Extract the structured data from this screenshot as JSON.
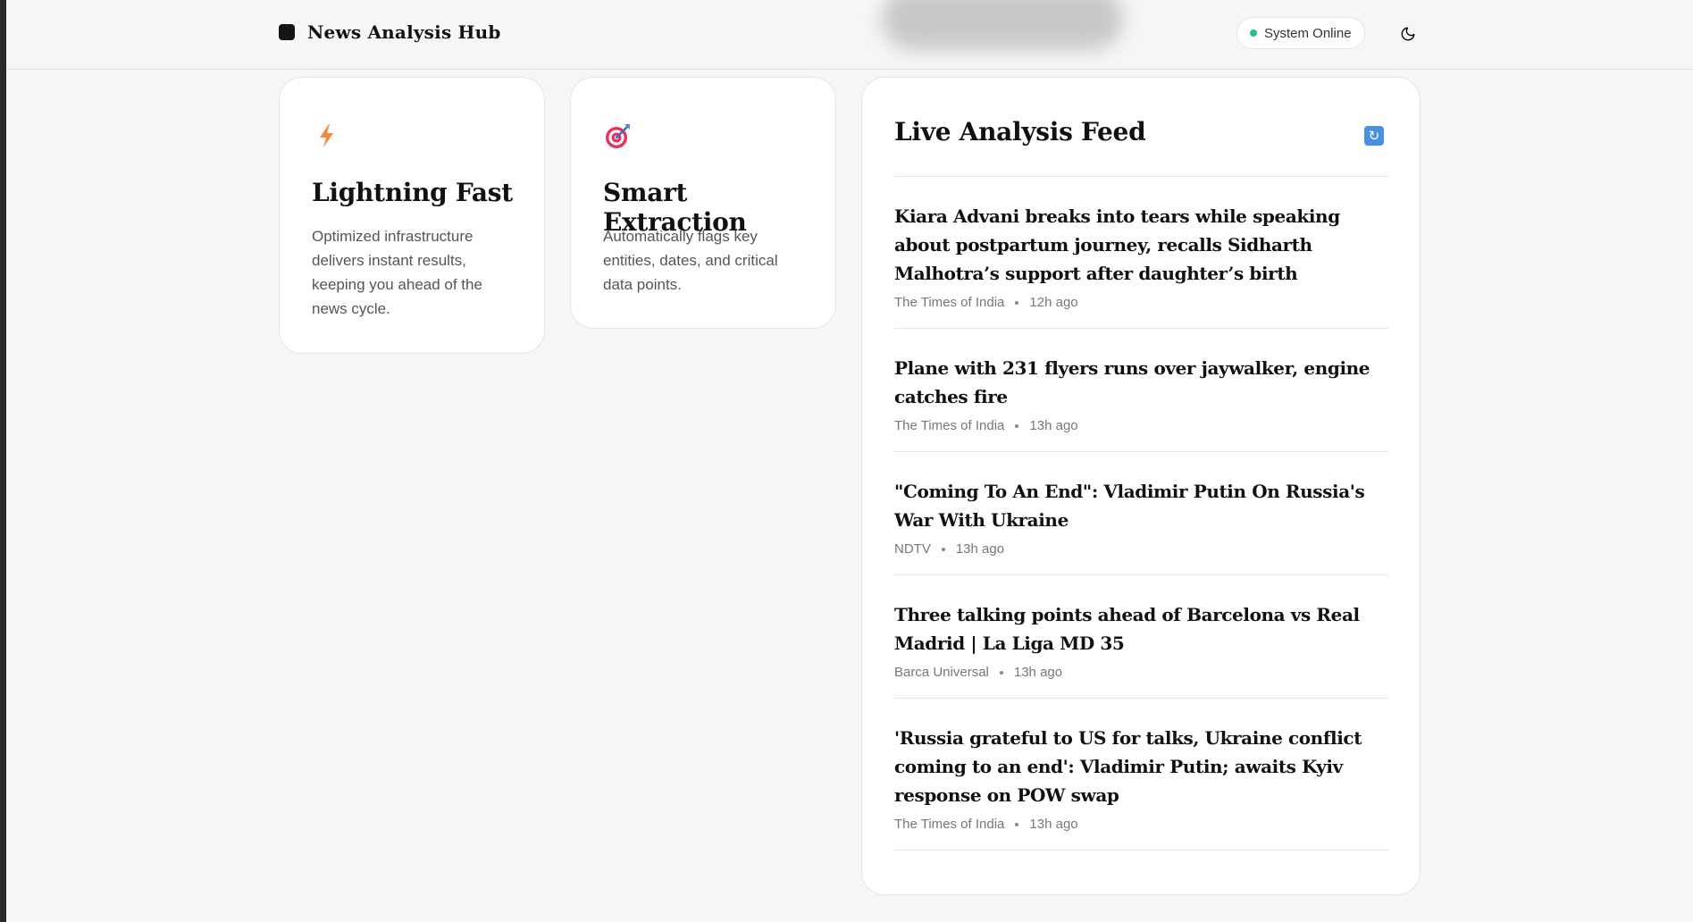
{
  "header": {
    "brand": "News Analysis Hub",
    "status": "System Online",
    "status_color": "#22c08b"
  },
  "features": [
    {
      "icon": "lightning-icon",
      "title": "Lightning Fast",
      "description": "Optimized infrastructure delivers instant results, keeping you ahead of the news cycle."
    },
    {
      "icon": "target-icon",
      "title": "Smart Extraction",
      "description": "Automatically flags key entities, dates, and critical data points."
    }
  ],
  "feed": {
    "title": "Live Analysis Feed",
    "refresh_icon": "refresh-icon",
    "items": [
      {
        "headline": "Kiara Advani breaks into tears while speaking about postpartum journey, recalls Sidharth Malhotra’s support after daughter’s birth",
        "source": "The Times of India",
        "time": "12h ago"
      },
      {
        "headline": "Plane with 231 flyers runs over jaywalker, engine catches fire",
        "source": "The Times of India",
        "time": "13h ago"
      },
      {
        "headline": "\"Coming To An End\": Vladimir Putin On Russia's War With Ukraine",
        "source": "NDTV",
        "time": "13h ago"
      },
      {
        "headline": "Three talking points ahead of Barcelona vs Real Madrid | La Liga MD 35",
        "source": "Barca Universal",
        "time": "13h ago"
      },
      {
        "headline": "'Russia grateful to US for talks, Ukraine conflict coming to an end': Vladimir Putin; awaits Kyiv response on POW swap",
        "source": "The Times of India",
        "time": "13h ago"
      }
    ]
  }
}
